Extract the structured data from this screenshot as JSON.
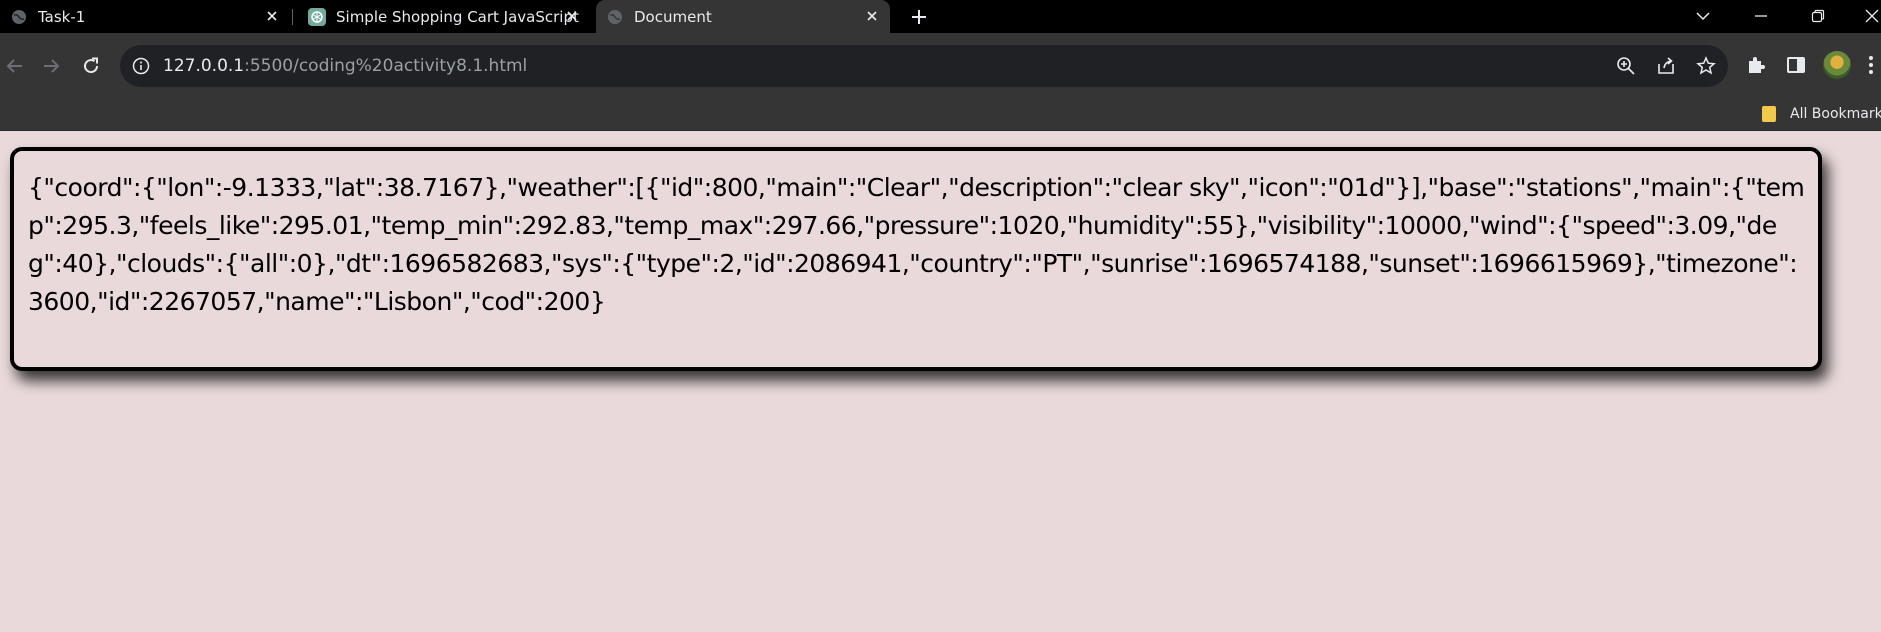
{
  "browser": {
    "tabs": [
      {
        "label": "Task-1",
        "favicon": "globe-icon",
        "active": false
      },
      {
        "label": "Simple Shopping Cart JavaScript",
        "favicon": "chatgpt-icon",
        "active": false
      },
      {
        "label": "Document",
        "favicon": "globe-icon",
        "active": true
      }
    ],
    "address_bar": {
      "host": "127.0.0.1",
      "rest": ":5500/coding%20activity8.1.html"
    },
    "bookmarks": {
      "all_bookmarks_label": "All Bookmarks"
    },
    "colors": {
      "tabstrip": "#000000",
      "toolbar": "#353535",
      "omnibox": "#202124",
      "page_background": "#e9d9da"
    }
  },
  "page": {
    "json_output": "{\"coord\":{\"lon\":-9.1333,\"lat\":38.7167},\"weather\":[{\"id\":800,\"main\":\"Clear\",\"description\":\"clear sky\",\"icon\":\"01d\"}],\"base\":\"stations\",\"main\":{\"temp\":295.3,\"feels_like\":295.01,\"temp_min\":292.83,\"temp_max\":297.66,\"pressure\":1020,\"humidity\":55},\"visibility\":10000,\"wind\":{\"speed\":3.09,\"deg\":40},\"clouds\":{\"all\":0},\"dt\":1696582683,\"sys\":{\"type\":2,\"id\":2086941,\"country\":\"PT\",\"sunrise\":1696574188,\"sunset\":1696615969},\"timezone\":3600,\"id\":2267057,\"name\":\"Lisbon\",\"cod\":200}"
  }
}
